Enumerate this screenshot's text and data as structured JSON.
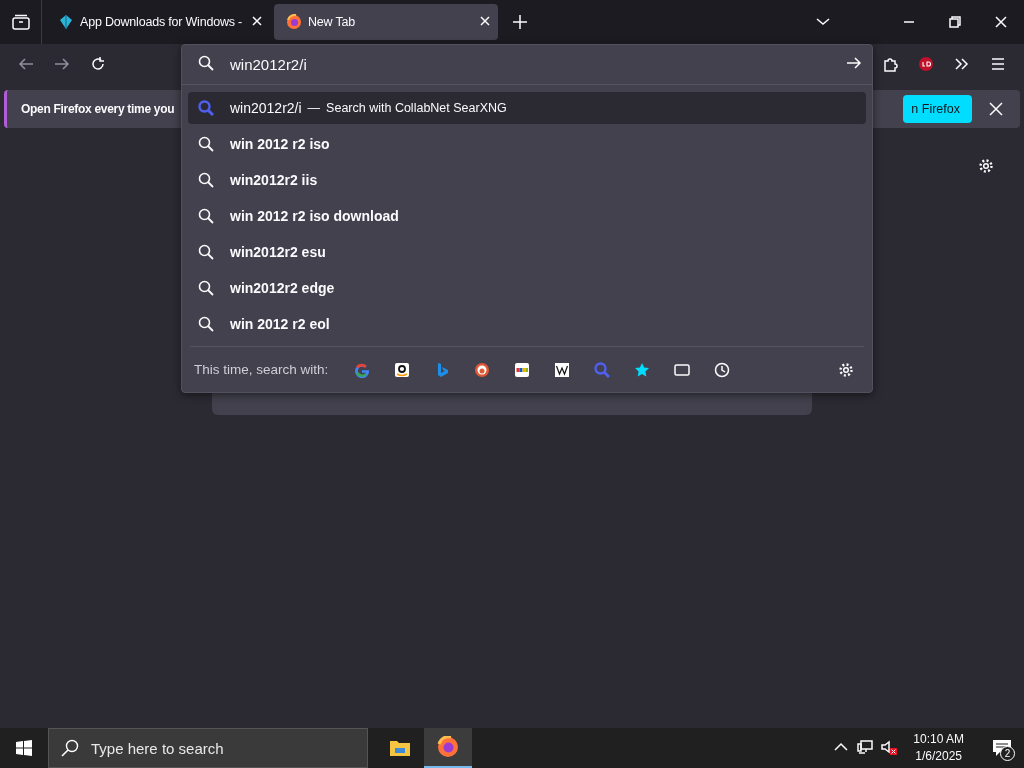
{
  "tabs": [
    {
      "title": "App Downloads for Windows -",
      "selected": false
    },
    {
      "title": "New Tab",
      "selected": true
    }
  ],
  "notification": {
    "message": "Open Firefox every time you",
    "button": "n Firefox"
  },
  "address_bar": {
    "value": "win2012r2/i"
  },
  "suggestions": [
    {
      "kind": "engine",
      "query": "win2012r2/i",
      "separator": "—",
      "action": "Search with CollabNet SearXNG",
      "selected": true
    },
    {
      "kind": "term",
      "query": "win 2012 r2 iso",
      "selected": false
    },
    {
      "kind": "term",
      "query": "win2012r2 iis",
      "selected": false
    },
    {
      "kind": "term",
      "query": "win 2012 r2 iso download",
      "selected": false
    },
    {
      "kind": "term",
      "query": "win2012r2 esu",
      "selected": false
    },
    {
      "kind": "term",
      "query": "win2012r2 edge",
      "selected": false
    },
    {
      "kind": "term",
      "query": "win 2012 r2 eol",
      "selected": false
    }
  ],
  "search_with": {
    "label": "This time, search with:"
  },
  "taskbar": {
    "search_placeholder": "Type here to search",
    "time": "10:10 AM",
    "date": "1/6/2025",
    "notification_count": "2"
  }
}
